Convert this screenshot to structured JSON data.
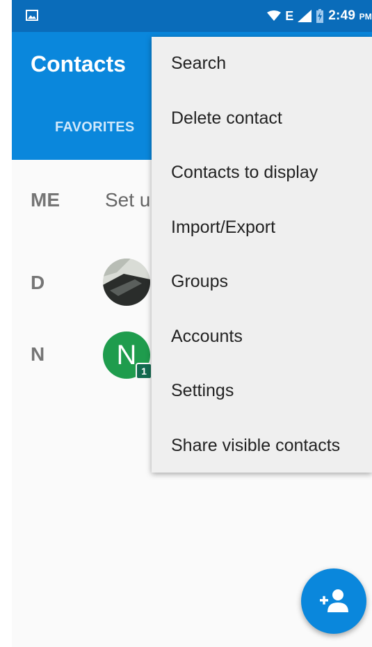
{
  "status_bar": {
    "time": "2:49",
    "ampm": "PM",
    "network": "E",
    "icons": [
      "gallery-icon",
      "wifi-icon",
      "signal-icon",
      "battery-charging-icon"
    ]
  },
  "app_bar": {
    "title": "Contacts",
    "tabs": [
      {
        "label": "FAVORITES"
      }
    ]
  },
  "contacts": {
    "me_section": {
      "letter": "ME",
      "text": "Set u"
    },
    "sections": [
      {
        "letter": "D",
        "avatar": "photo"
      },
      {
        "letter": "N",
        "avatar_letter": "N",
        "badge": "1"
      }
    ]
  },
  "overflow_menu": {
    "items": [
      {
        "label": "Search"
      },
      {
        "label": "Delete contact"
      },
      {
        "label": "Contacts to display"
      },
      {
        "label": "Import/Export"
      },
      {
        "label": "Groups"
      },
      {
        "label": "Accounts"
      },
      {
        "label": "Settings"
      },
      {
        "label": "Share visible contacts"
      }
    ]
  },
  "fab": {
    "icon": "add-person-icon"
  },
  "colors": {
    "status_bar": "#0a6cba",
    "app_bar": "#0a87dc",
    "menu_bg": "#efefef",
    "avatar_green": "#1f9c4d"
  }
}
